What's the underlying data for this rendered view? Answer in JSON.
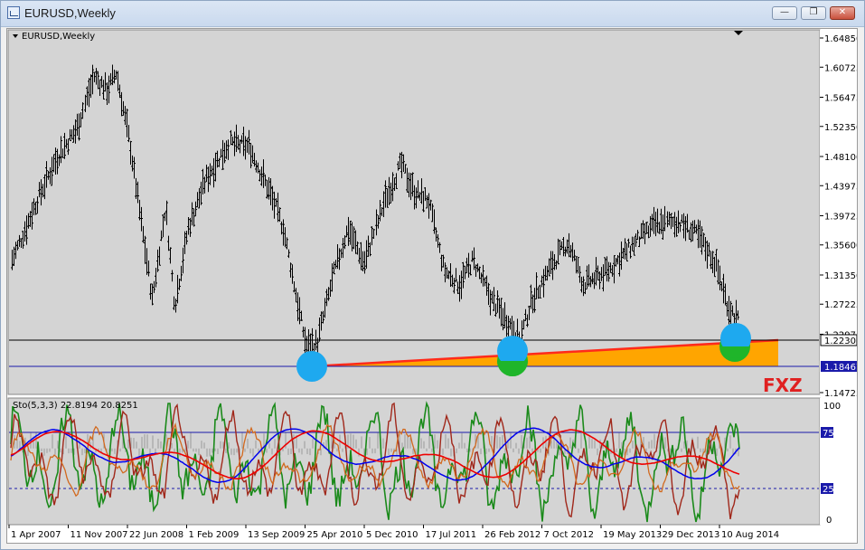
{
  "window": {
    "title": "EURUSD,Weekly",
    "minimize_label": "—",
    "maximize_label": "❐",
    "close_label": "✕"
  },
  "main_chart": {
    "label": "EURUSD,Weekly",
    "collapse_icon": "triangle-down-icon",
    "price_axis_ticks": [
      "1.64850",
      "1.60725",
      "1.56475",
      "1.52350",
      "1.48100",
      "1.43975",
      "1.39725",
      "1.35600",
      "1.31350",
      "1.27225",
      "1.22975",
      "1.14725"
    ],
    "price_tags": [
      {
        "value": "1.22304",
        "price": 1.22304
      },
      {
        "value": "1.18467",
        "price": 1.18467
      }
    ],
    "watermark": "FXZ",
    "colors": {
      "bars": "#000000",
      "support_line": "#ff2a1a",
      "fill": "#ffa500",
      "level_line": "#0000cc",
      "circle_blue": "#1ea9ef",
      "circle_green": "#1fb52a",
      "watermark": "#e02020"
    }
  },
  "stochastic": {
    "label": "Sto(5,3,3) 22.8194 20.8251",
    "axis_ticks": [
      "100",
      "75",
      "25",
      "0"
    ],
    "level_lines": [
      75,
      25
    ]
  },
  "time_axis": [
    "1 Apr 2007",
    "11 Nov 2007",
    "22 Jun 2008",
    "1 Feb 2009",
    "13 Sep 2009",
    "25 Apr 2010",
    "5 Dec 2010",
    "17 Jul 2011",
    "26 Feb 2012",
    "7 Oct 2012",
    "19 May 2013",
    "29 Dec 2013",
    "10 Aug 2014"
  ],
  "chart_data": {
    "type": "line",
    "title": "EURUSD,Weekly",
    "xlabel": "",
    "ylabel": "",
    "ylim": [
      1.14725,
      1.66
    ],
    "x": [
      "1 Apr 2007",
      "11 Nov 2007",
      "22 Jun 2008",
      "1 Feb 2009",
      "13 Sep 2009",
      "25 Apr 2010",
      "5 Dec 2010",
      "17 Jul 2011",
      "26 Feb 2012",
      "7 Oct 2012",
      "19 May 2013",
      "29 Dec 2013",
      "10 Aug 2014"
    ],
    "series": [
      {
        "values": [
          1.335,
          1.47,
          1.575,
          1.28,
          1.505,
          1.325,
          1.33,
          1.42,
          1.315,
          1.295,
          1.31,
          1.375,
          1.335
        ]
      }
    ],
    "annotations": [
      {
        "type": "horizontal_line",
        "price": 1.22304
      },
      {
        "type": "horizontal_line",
        "price": 1.18467
      },
      {
        "type": "trendline",
        "from": "Jun 2010",
        "to": "Sep 2014"
      }
    ]
  }
}
